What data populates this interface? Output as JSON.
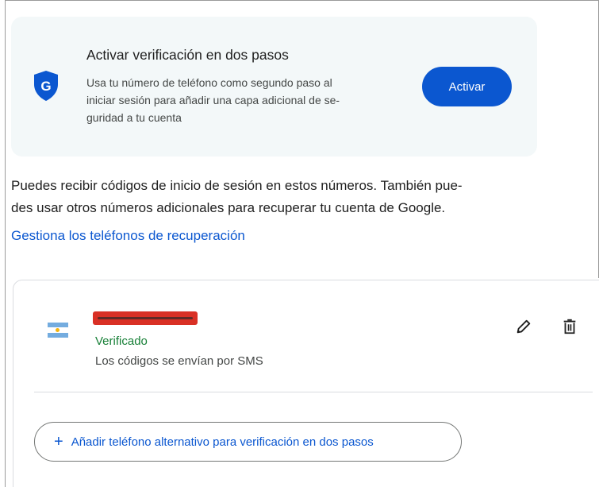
{
  "promo": {
    "title": "Activar verificación en dos pasos",
    "description": "Usa tu número de teléfono como segundo paso al\niniciar sesión para añadir una capa adicional de se-\nguridad a tu cuenta",
    "button_label": "Activar",
    "shield_letter": "G",
    "icon": "google-shield-icon"
  },
  "info": {
    "text": "Puedes recibir códigos de inicio de sesión en estos números. También pue-\ndes usar otros números adicionales para recuperar tu cuenta de Google.",
    "link": "Gestiona los teléfonos de recuperación"
  },
  "phone": {
    "flag_icon": "argentina-flag-icon",
    "status": "Verificado",
    "detail": "Los códigos se envían por SMS",
    "edit_icon": "pencil-icon",
    "delete_icon": "trash-icon"
  },
  "add_button": {
    "icon": "plus-icon",
    "label": "Añadir teléfono alternativo para verificación en dos pasos"
  },
  "colors": {
    "accent": "#0b57d0",
    "verified": "#188038",
    "promo_bg": "#f3f8f9",
    "redaction": "#d93025"
  }
}
